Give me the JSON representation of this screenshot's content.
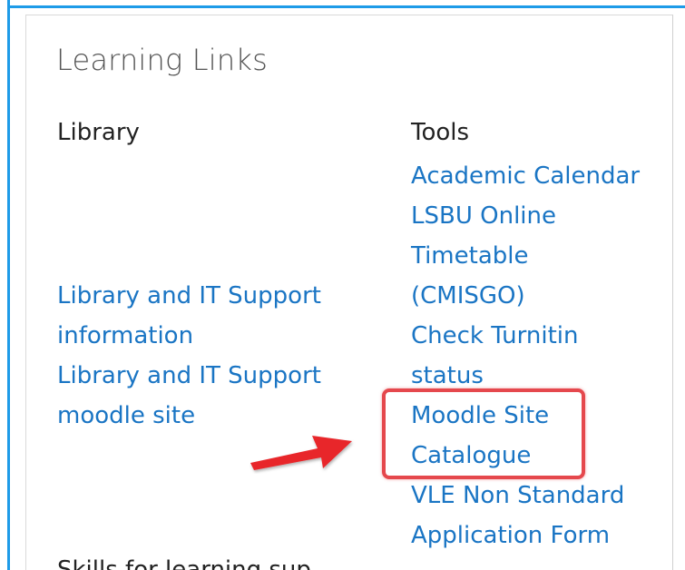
{
  "panel": {
    "title": "Learning Links"
  },
  "library": {
    "heading": "Library",
    "links": [
      {
        "line1": "Library and IT Support",
        "line2": "information"
      },
      {
        "line1": "Library and IT Support",
        "line2": "moodle site"
      }
    ]
  },
  "tools": {
    "heading": "Tools",
    "links": [
      {
        "line1": "Academic Calendar"
      },
      {
        "line1": "LSBU Online",
        "line2": "Timetable",
        "line3": "(CMISGO)"
      },
      {
        "line1": "Check Turnitin",
        "line2": "status"
      },
      {
        "line1": "Moodle Site",
        "line2": "Catalogue"
      },
      {
        "line1": "VLE Non Standard",
        "line2": "Application Form"
      }
    ]
  },
  "partially_visible_heading": "Skills for learning sup",
  "colors": {
    "link": "#1a75c4",
    "frame": "#1e9be8",
    "highlight": "#e5484d",
    "arrow": "#e8262a"
  }
}
